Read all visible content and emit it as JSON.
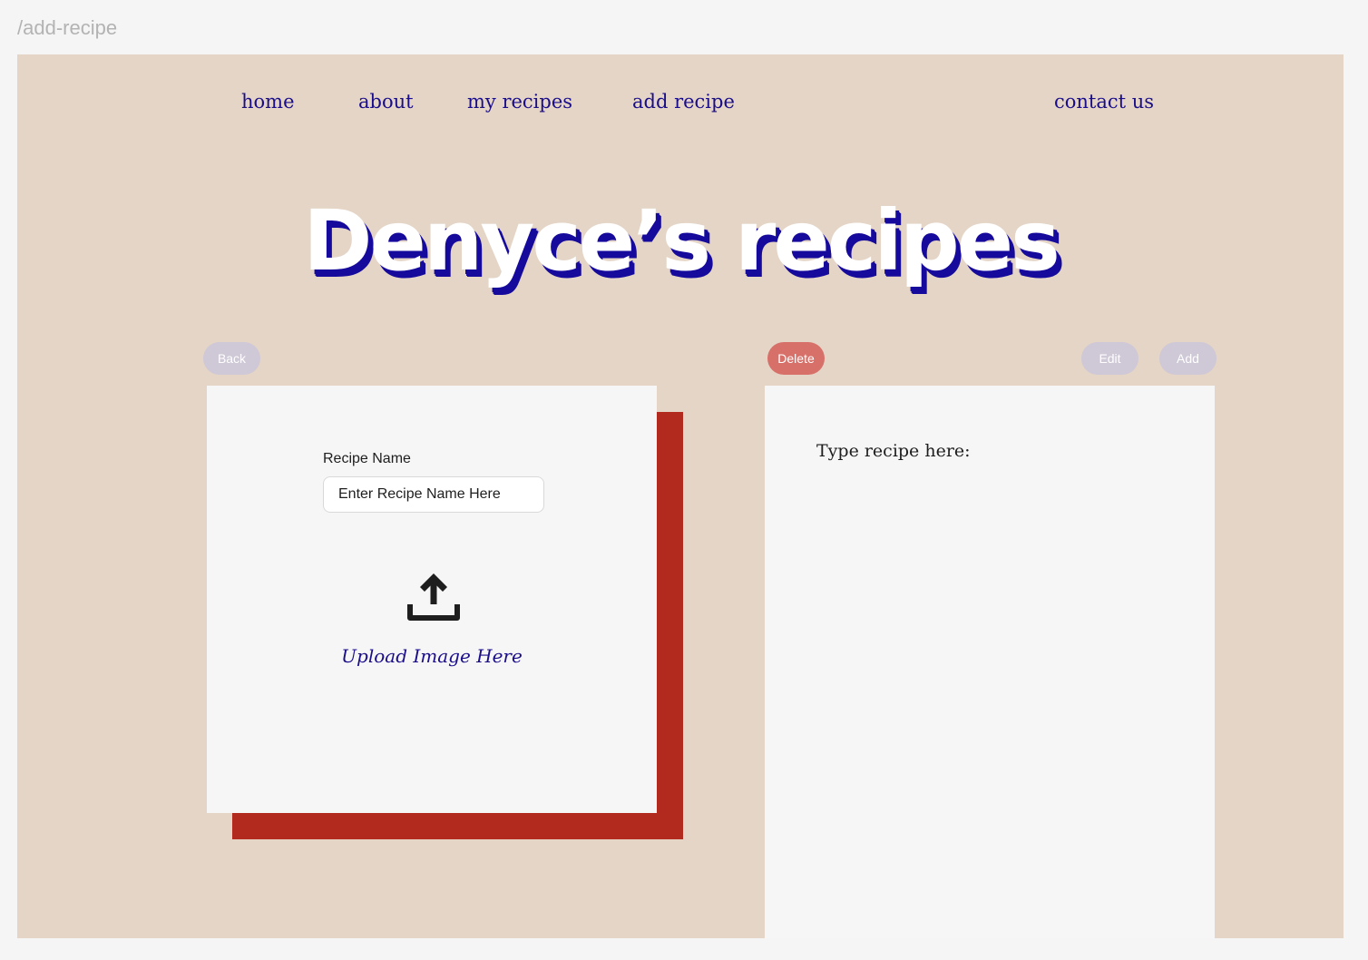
{
  "frame_label": "/add-recipe",
  "nav": {
    "home": "home",
    "about": "about",
    "my_recipes": "my recipes",
    "add_recipe": "add recipe",
    "contact_us": "contact us"
  },
  "hero": {
    "title": "Denyce’s recipes"
  },
  "buttons": {
    "back": "Back",
    "delete": "Delete",
    "edit": "Edit",
    "add": "Add"
  },
  "recipe_form": {
    "name_label": "Recipe Name",
    "name_placeholder": "Enter Recipe Name Here",
    "upload_label": "Upload Image Here",
    "upload_icon": "upload-icon"
  },
  "recipe_editor": {
    "placeholder": "Type recipe here:"
  },
  "colors": {
    "page_bg": "#f5f5f5",
    "frame_bg": "#e4d5c6",
    "nav_text": "#1a0d8a",
    "title_shadow": "#160a9c",
    "card_bg": "#f6f6f6",
    "card_shadow": "#b2291d",
    "button_muted": "#cfc8d6",
    "button_danger": "#d8706a"
  }
}
